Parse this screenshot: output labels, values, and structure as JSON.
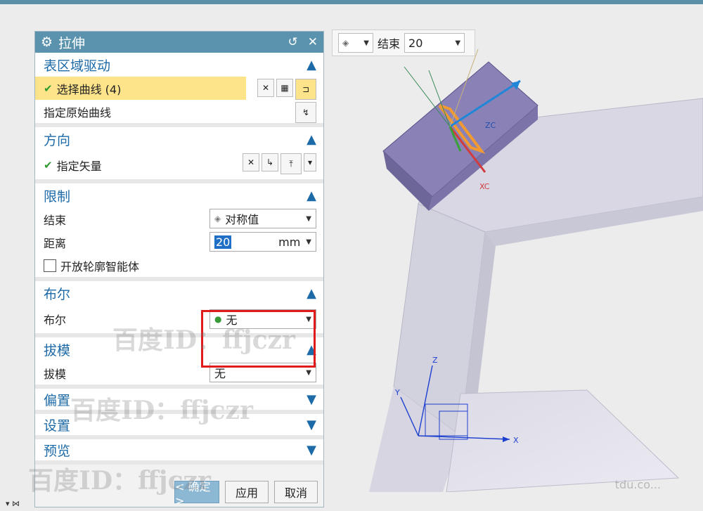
{
  "dialog": {
    "title": "拉伸",
    "sections": {
      "section1": {
        "title": "表区域驱动",
        "select_curve": "选择曲线 (4)",
        "orig_curve": "指定原始曲线"
      },
      "direction": {
        "title": "方向",
        "vector": "指定矢量"
      },
      "limit": {
        "title": "限制",
        "end_label": "结束",
        "end_value": "对称值",
        "dist_label": "距离",
        "dist_value": "20",
        "dist_unit": "mm",
        "open_profile": "开放轮廓智能体"
      },
      "bool": {
        "title": "布尔",
        "label": "布尔",
        "value": "无"
      },
      "draft": {
        "title": "拔模",
        "label": "拔模",
        "value": "无"
      },
      "offset": {
        "title": "偏置"
      },
      "settings": {
        "title": "设置"
      },
      "preview": {
        "title": "预览"
      }
    },
    "buttons": {
      "ok": "< 确定 >",
      "apply": "应用",
      "cancel": "取消"
    }
  },
  "minibar": {
    "end_label": "结束",
    "end_value": "20"
  },
  "viewport": {
    "axis_labels": [
      "ZC",
      "XC",
      "Z",
      "Y",
      "X"
    ]
  },
  "watermarks": [
    "百度ID：ffjczr",
    "百度ID：ffjczr",
    "百度ID：ffjczr"
  ],
  "corner_text": "tdu.co..."
}
